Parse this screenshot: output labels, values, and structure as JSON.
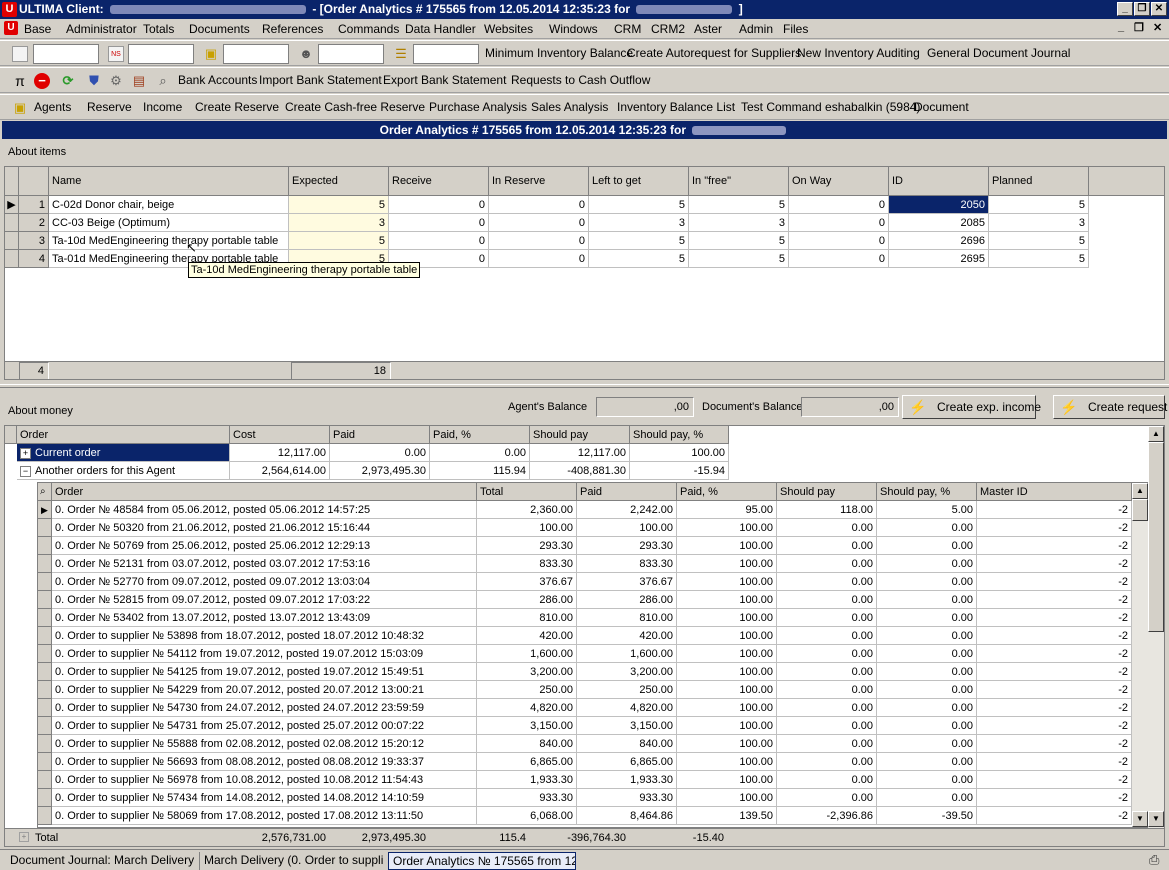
{
  "window": {
    "app_label": "ULTIMA Client:",
    "title_prefix": "- [Order Analytics # 175565 from 12.05.2014 12:35:23 for",
    "title_suffix": "]",
    "controls": {
      "minimize": "_",
      "restore": "❐",
      "close": "✕"
    }
  },
  "menu": {
    "items": [
      "Base",
      "Administrator",
      "Totals",
      "Documents",
      "References",
      "Commands",
      "Data Handler",
      "Websites",
      "Windows",
      "CRM",
      "CRM2",
      "Aster",
      "Admin",
      "Files"
    ],
    "mdi": {
      "minimize": "_",
      "restore": "❐",
      "close": "✕"
    }
  },
  "toolbar1": {
    "items": [
      "Minimum Inventory Balance",
      "Create Autorequest for Suppliers",
      "New Inventory Auditing",
      "General Document Journal"
    ]
  },
  "toolbar2": {
    "pi": "π",
    "items": [
      "Bank Accounts",
      "Import Bank Statement",
      "Export Bank Statement",
      "Requests to Cash Outflow"
    ]
  },
  "toolbar3": {
    "items": [
      "Agents",
      "Reserve",
      "Income",
      "Create Reserve",
      "Create Cash-free Reserve",
      "Purchase Analysis",
      "Sales Analysis",
      "Inventory Balance List",
      "Test Command eshabalkin (5984)",
      "Document"
    ]
  },
  "caption": {
    "prefix": "Order Analytics # 175565 from 12.05.2014 12:35:23 for"
  },
  "items_section": {
    "label": "About items",
    "columns": [
      "Name",
      "Expected",
      "Receive",
      "In Reserve",
      "Left to get",
      "In \"free\"",
      "On Way",
      "ID",
      "Planned"
    ],
    "rows": [
      {
        "n": "1",
        "name": "C-02d Donor chair, beige",
        "expected": "5",
        "receive": "0",
        "reserve": "0",
        "left": "5",
        "free": "5",
        "onway": "0",
        "id": "2050",
        "planned": "5"
      },
      {
        "n": "2",
        "name": "CC-03 Beige (Optimum)",
        "expected": "3",
        "receive": "0",
        "reserve": "0",
        "left": "3",
        "free": "3",
        "onway": "0",
        "id": "2085",
        "planned": "3"
      },
      {
        "n": "3",
        "name": "Ta-10d MedEngineering therapy portable table",
        "expected": "5",
        "receive": "0",
        "reserve": "0",
        "left": "5",
        "free": "5",
        "onway": "0",
        "id": "2696",
        "planned": "5"
      },
      {
        "n": "4",
        "name": "Ta-01d MedEngineering therapy portable table",
        "expected": "5",
        "receive": "0",
        "reserve": "0",
        "left": "5",
        "free": "5",
        "onway": "0",
        "id": "2695",
        "planned": "5"
      }
    ],
    "footer_count": "4",
    "footer_expected": "18",
    "tooltip": "Ta-10d MedEngineering therapy portable table"
  },
  "money_section": {
    "label": "About money",
    "agent_balance_label": "Agent's Balance",
    "agent_balance_value": ",00",
    "document_balance_label": "Document's Balance",
    "document_balance_value": ",00",
    "create_exp_income": "Create exp. income",
    "create_request": "Create request",
    "columns": [
      "Order",
      "Cost",
      "Paid",
      "Paid, %",
      "Should pay",
      "Should pay, %"
    ],
    "groups": [
      {
        "expander": "+",
        "order": "Current order",
        "cost": "12,117.00",
        "paid": "0.00",
        "paid_pct": "0.00",
        "should": "12,117.00",
        "should_pct": "100.00"
      },
      {
        "expander": "−",
        "order": "Another orders for this Agent",
        "cost": "2,564,614.00",
        "paid": "2,973,495.30",
        "paid_pct": "115.94",
        "should": "-408,881.30",
        "should_pct": "-15.94"
      }
    ],
    "detail_columns": [
      "Order",
      "Total",
      "Paid",
      "Paid, %",
      "Should pay",
      "Should pay, %",
      "Master ID"
    ],
    "detail_rows": [
      {
        "order": "0. Order № 48584 from 05.06.2012, posted 05.06.2012 14:57:25",
        "total": "2,360.00",
        "paid": "2,242.00",
        "pct": "95.00",
        "should": "118.00",
        "spct": "5.00",
        "mid": "-2"
      },
      {
        "order": "0. Order № 50320 from 21.06.2012, posted 21.06.2012 15:16:44",
        "total": "100.00",
        "paid": "100.00",
        "pct": "100.00",
        "should": "0.00",
        "spct": "0.00",
        "mid": "-2"
      },
      {
        "order": "0. Order № 50769 from 25.06.2012, posted 25.06.2012 12:29:13",
        "total": "293.30",
        "paid": "293.30",
        "pct": "100.00",
        "should": "0.00",
        "spct": "0.00",
        "mid": "-2"
      },
      {
        "order": "0. Order № 52131 from 03.07.2012, posted 03.07.2012 17:53:16",
        "total": "833.30",
        "paid": "833.30",
        "pct": "100.00",
        "should": "0.00",
        "spct": "0.00",
        "mid": "-2"
      },
      {
        "order": "0. Order № 52770 from 09.07.2012, posted 09.07.2012 13:03:04",
        "total": "376.67",
        "paid": "376.67",
        "pct": "100.00",
        "should": "0.00",
        "spct": "0.00",
        "mid": "-2"
      },
      {
        "order": "0. Order № 52815 from 09.07.2012, posted 09.07.2012 17:03:22",
        "total": "286.00",
        "paid": "286.00",
        "pct": "100.00",
        "should": "0.00",
        "spct": "0.00",
        "mid": "-2"
      },
      {
        "order": "0. Order № 53402 from 13.07.2012, posted 13.07.2012 13:43:09",
        "total": "810.00",
        "paid": "810.00",
        "pct": "100.00",
        "should": "0.00",
        "spct": "0.00",
        "mid": "-2"
      },
      {
        "order": "0. Order to supplier № 53898 from 18.07.2012, posted 18.07.2012 10:48:32",
        "total": "420.00",
        "paid": "420.00",
        "pct": "100.00",
        "should": "0.00",
        "spct": "0.00",
        "mid": "-2"
      },
      {
        "order": "0. Order to supplier № 54112 from 19.07.2012, posted 19.07.2012 15:03:09",
        "total": "1,600.00",
        "paid": "1,600.00",
        "pct": "100.00",
        "should": "0.00",
        "spct": "0.00",
        "mid": "-2"
      },
      {
        "order": "0. Order to supplier № 54125 from 19.07.2012, posted 19.07.2012 15:49:51",
        "total": "3,200.00",
        "paid": "3,200.00",
        "pct": "100.00",
        "should": "0.00",
        "spct": "0.00",
        "mid": "-2"
      },
      {
        "order": "0. Order to supplier № 54229 from 20.07.2012, posted 20.07.2012 13:00:21",
        "total": "250.00",
        "paid": "250.00",
        "pct": "100.00",
        "should": "0.00",
        "spct": "0.00",
        "mid": "-2"
      },
      {
        "order": "0. Order to supplier № 54730 from 24.07.2012, posted 24.07.2012 23:59:59",
        "total": "4,820.00",
        "paid": "4,820.00",
        "pct": "100.00",
        "should": "0.00",
        "spct": "0.00",
        "mid": "-2"
      },
      {
        "order": "0. Order to supplier № 54731 from 25.07.2012, posted 25.07.2012 00:07:22",
        "total": "3,150.00",
        "paid": "3,150.00",
        "pct": "100.00",
        "should": "0.00",
        "spct": "0.00",
        "mid": "-2"
      },
      {
        "order": "0. Order to supplier № 55888 from 02.08.2012, posted 02.08.2012 15:20:12",
        "total": "840.00",
        "paid": "840.00",
        "pct": "100.00",
        "should": "0.00",
        "spct": "0.00",
        "mid": "-2"
      },
      {
        "order": "0. Order to supplier № 56693 from 08.08.2012, posted 08.08.2012 19:33:37",
        "total": "6,865.00",
        "paid": "6,865.00",
        "pct": "100.00",
        "should": "0.00",
        "spct": "0.00",
        "mid": "-2"
      },
      {
        "order": "0. Order to supplier № 56978 from 10.08.2012, posted 10.08.2012 11:54:43",
        "total": "1,933.30",
        "paid": "1,933.30",
        "pct": "100.00",
        "should": "0.00",
        "spct": "0.00",
        "mid": "-2"
      },
      {
        "order": "0. Order to supplier № 57434 from 14.08.2012, posted 14.08.2012 14:10:59",
        "total": "933.30",
        "paid": "933.30",
        "pct": "100.00",
        "should": "0.00",
        "spct": "0.00",
        "mid": "-2"
      },
      {
        "order": "0. Order to supplier № 58069 from 17.08.2012, posted 17.08.2012 13:11:50",
        "total": "6,068.00",
        "paid": "8,464.86",
        "pct": "139.50",
        "should": "-2,396.86",
        "spct": "-39.50",
        "mid": "-2"
      }
    ],
    "total": {
      "label": "Total",
      "cost": "2,576,731.00",
      "paid": "2,973,495.30",
      "paid_pct": "115.4",
      "should": "-396,764.30",
      "should_pct": "-15.40"
    }
  },
  "statusbar": {
    "tabs": [
      "Document Journal: March Delivery ...",
      "March Delivery (0. Order to suppli...",
      "Order Analytics № 175565 from 12...."
    ]
  },
  "colors": {
    "title_bg": "#0a246a",
    "accent": "#e00000",
    "selected": "#0a246a",
    "expected_bg": "#fffbe0"
  }
}
